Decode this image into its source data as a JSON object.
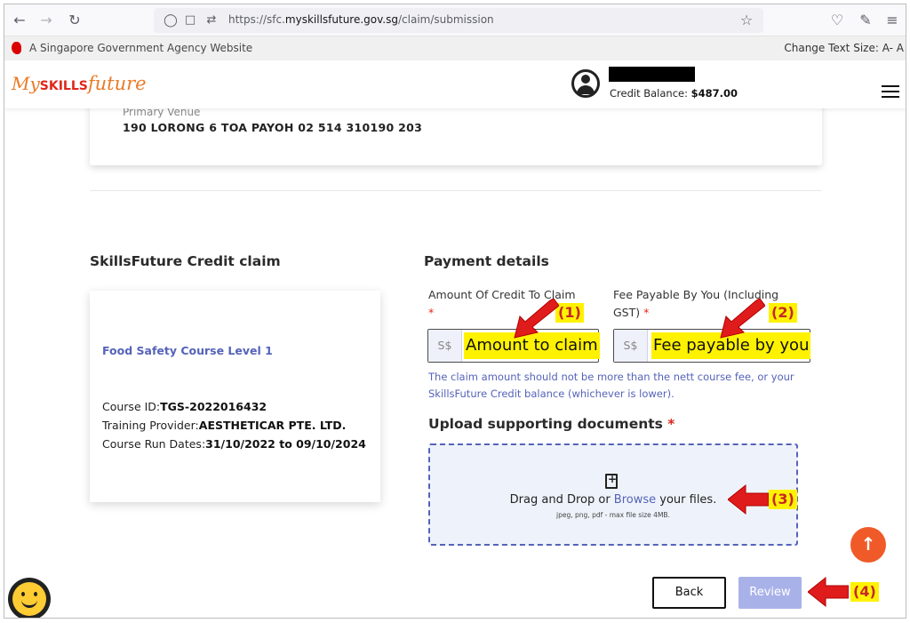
{
  "browser": {
    "url_prefix": "https://sfc.",
    "url_host": "myskillsfuture.gov.sg",
    "url_path": "/claim/submission",
    "icons": [
      "back-icon",
      "forward-icon",
      "reload-icon",
      "shield-icon",
      "lock-icon",
      "permissions-icon",
      "bookmark-star-icon",
      "pocket-icon",
      "extensions-icon",
      "menu-icon"
    ]
  },
  "govbar": {
    "text": "A Singapore Government Agency Website",
    "text_size": "Change Text Size: A- A"
  },
  "header": {
    "logo_my": "My",
    "logo_skills": "SKILLS",
    "logo_future": "future",
    "credit_label": "Credit Balance:",
    "credit_value": "$487.00"
  },
  "venue": {
    "label": "Primary Venue",
    "value": "190 LORONG 6 TOA PAYOH 02 514 310190 203"
  },
  "claim": {
    "title": "SkillsFuture Credit claim",
    "course_name": "Food Safety Course Level 1",
    "course_id_label": "Course ID:",
    "course_id": "TGS-2022016432",
    "provider_label": "Training Provider:",
    "provider": "AESTHETICAR PTE. LTD.",
    "dates_label": "Course Run Dates:",
    "dates": "31/10/2022 to 09/10/2024"
  },
  "payment": {
    "title": "Payment details",
    "amount_label": "Amount Of Credit To Claim",
    "fee_label_line1": "Fee Payable By You (Including",
    "fee_label_line2": "GST)",
    "required_mark": "*",
    "prefix": "S$",
    "amount_placeholder": "Amount to claim",
    "fee_placeholder": "Fee payable by you",
    "hint": "The claim amount should not be more than the nett course fee, or your SkillsFuture Credit balance (whichever is lower)."
  },
  "upload": {
    "title": "Upload supporting documents",
    "drop_text_before": "Drag and Drop or ",
    "browse": "Browse",
    "drop_text_after": " your files.",
    "formats": "jpeg, png, pdf - max file size 4MB."
  },
  "annotations": {
    "a1": "(1)",
    "a2": "(2)",
    "a3": "(3)",
    "a4": "(4)",
    "color": "#c62828",
    "highlight": "#fff200"
  },
  "actions": {
    "back": "Back",
    "review": "Review"
  }
}
